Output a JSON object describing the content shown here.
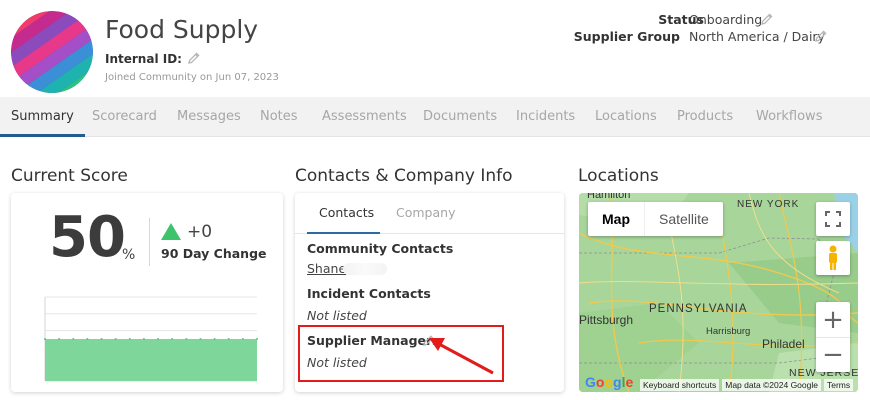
{
  "header": {
    "title": "Food Supply",
    "internal_id_label": "Internal ID:",
    "joined_text": "Joined Community on Jun 07, 2023",
    "status_label": "Status",
    "status_value": "Onboarding",
    "supplier_group_label": "Supplier Group",
    "supplier_group_value": "North America / Dairy"
  },
  "tabs": [
    {
      "label": "Summary",
      "active": true
    },
    {
      "label": "Scorecard"
    },
    {
      "label": "Messages"
    },
    {
      "label": "Notes"
    },
    {
      "label": "Assessments"
    },
    {
      "label": "Documents"
    },
    {
      "label": "Incidents"
    },
    {
      "label": "Locations"
    },
    {
      "label": "Products"
    },
    {
      "label": "Workflows"
    }
  ],
  "score": {
    "title": "Current Score",
    "value": "50",
    "unit": "%",
    "change": "+0",
    "change_label": "90 Day Change",
    "chart_data": {
      "type": "area",
      "values": [
        50,
        50,
        50,
        50,
        50,
        50,
        50,
        50,
        50,
        50,
        50,
        50,
        50,
        50,
        50,
        50
      ],
      "ylim": [
        0,
        100
      ],
      "grid": true
    }
  },
  "contacts": {
    "title": "Contacts & Company Info",
    "tab_contacts": "Contacts",
    "tab_company": "Company",
    "community_label": "Community Contacts",
    "community_contact": "Shane",
    "incident_label": "Incident Contacts",
    "incident_value": "Not listed",
    "managers_label": "Supplier Managers",
    "managers_value": "Not listed"
  },
  "locations": {
    "title": "Locations",
    "map_btn": "Map",
    "satellite_btn": "Satellite",
    "zoom_in": "+",
    "zoom_out": "−",
    "labels": {
      "hamilton": "Hamilton",
      "new_york": "NEW YORK",
      "pittsburgh": "Pittsburgh",
      "pennsylvania": "PENNSYLVANIA",
      "harrisburg": "Harrisburg",
      "philadelphia": "Philadel",
      "new_jersey": "NEW JERSEY"
    },
    "google": "Google",
    "shortcuts": "Keyboard shortcuts",
    "map_data": "Map data ©2024 Google",
    "terms": "Terms"
  },
  "colors": {
    "accent": "#1f5c8f",
    "score_green": "#7ed69b",
    "change_up": "#3cc36b",
    "highlight": "#e21b1b"
  }
}
